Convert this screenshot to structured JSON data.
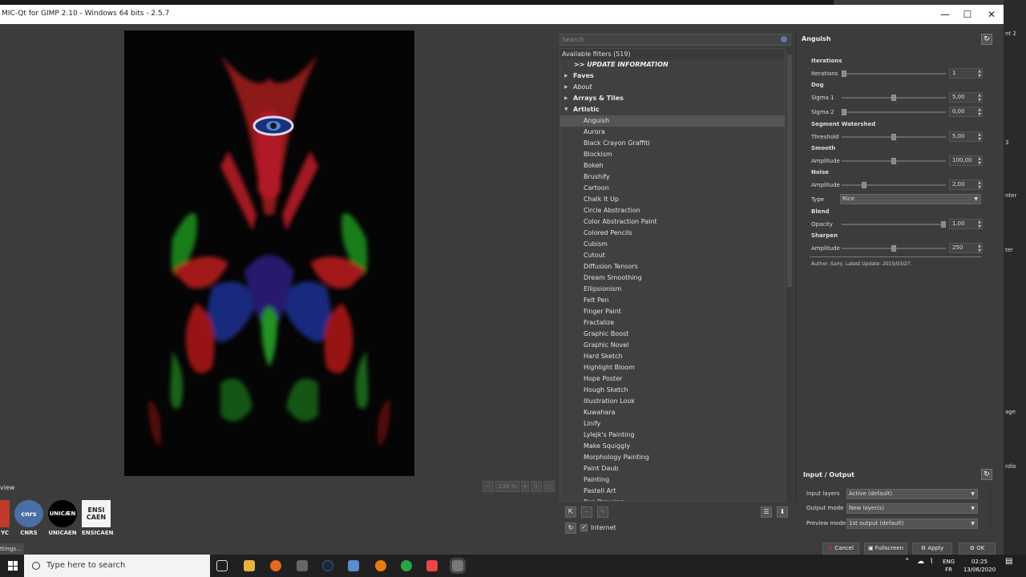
{
  "window": {
    "title": "MIC-Qt for GIMP 2.10 - Windows 64 bits - 2.5.7",
    "minimize": "—",
    "maximize": "☐",
    "close": "✕"
  },
  "preview": {
    "zoom": "228 %",
    "view_label": "view",
    "logos": [
      "YC",
      "CNRS",
      "UNICAEN",
      "ENSICAEN"
    ],
    "settings_label": "ttings..."
  },
  "filters": {
    "search_placeholder": "Search",
    "header": "Available filters (519)",
    "update": ">> UPDATE INFORMATION",
    "categories_top": [
      {
        "label": "Faves",
        "italic": false
      },
      {
        "label": "About",
        "italic": true
      },
      {
        "label": "Arrays & Tiles",
        "italic": false
      }
    ],
    "open_category": "Artistic",
    "items": [
      "Anguish",
      "Aurora",
      "Black Crayon Graffiti",
      "Blockism",
      "Bokeh",
      "Brushify",
      "Cartoon",
      "Chalk It Up",
      "Circle Abstraction",
      "Color Abstraction Paint",
      "Colored Pencils",
      "Cubism",
      "Cutout",
      "Diffusion Tensors",
      "Dream Smoothing",
      "Ellipsionism",
      "Felt Pen",
      "Finger Paint",
      "Fractalize",
      "Graphic Boost",
      "Graphic Novel",
      "Hard Sketch",
      "Highlight Bloom",
      "Hope Poster",
      "Hough Sketch",
      "Illustration Look",
      "Kuwahara",
      "Linify",
      "Lylejk's Painting",
      "Make Squiggly",
      "Morphology Painting",
      "Paint Daub",
      "Painting",
      "Pastell Art",
      "Pen Drawing"
    ],
    "selected_index": 0,
    "internet_label": "Internet"
  },
  "params": {
    "filter_name": "Anguish",
    "sections": {
      "iterations": "Iterations",
      "dog": "Dog",
      "segment": "Segment Watershed",
      "smooth": "Smooth",
      "noise": "Noise",
      "blend": "Blend",
      "sharpen": "Sharpen"
    },
    "iterations": {
      "label": "Iterations",
      "value": "1",
      "fraction": 0.0
    },
    "sigma1": {
      "label": "Sigma 1",
      "value": "5,00",
      "fraction": 0.5
    },
    "sigma2": {
      "label": "Sigma 2",
      "value": "0,00",
      "fraction": 0.0
    },
    "threshold": {
      "label": "Threshold",
      "value": "5,00",
      "fraction": 0.5
    },
    "smooth_amplitude": {
      "label": "Amplitude",
      "value": "100,00",
      "fraction": 0.5
    },
    "noise_amplitude": {
      "label": "Amplitude",
      "value": "2,00",
      "fraction": 0.2
    },
    "noise_type": {
      "label": "Type",
      "value": "Rice"
    },
    "opacity": {
      "label": "Opacity",
      "value": "1,00",
      "fraction": 1.0
    },
    "sharpen_amplitude": {
      "label": "Amplitude",
      "value": "250",
      "fraction": 0.5
    },
    "author_prefix": "Author:",
    "author": "Samj",
    "update_prefix": ". Latest Update:",
    "update_date": "2015/03/27."
  },
  "io": {
    "title": "Input / Output",
    "input_label": "Input layers",
    "input_value": "Active (default)",
    "output_label": "Output mode",
    "output_value": "New layer(s)",
    "preview_label": "Preview mode",
    "preview_value": "1st output (default)"
  },
  "buttons": {
    "cancel": "Cancel",
    "fullscreen": "Fullscreen",
    "apply": "Apply",
    "ok": "OK"
  },
  "taskbar": {
    "search_placeholder": "Type here to search",
    "lang1": "ENG",
    "lang2": "FR",
    "time": "02:25",
    "date": "13/06/2020"
  },
  "desktop_right": [
    "nt 2",
    "3",
    "nter",
    "ter",
    "age",
    "rdio"
  ]
}
